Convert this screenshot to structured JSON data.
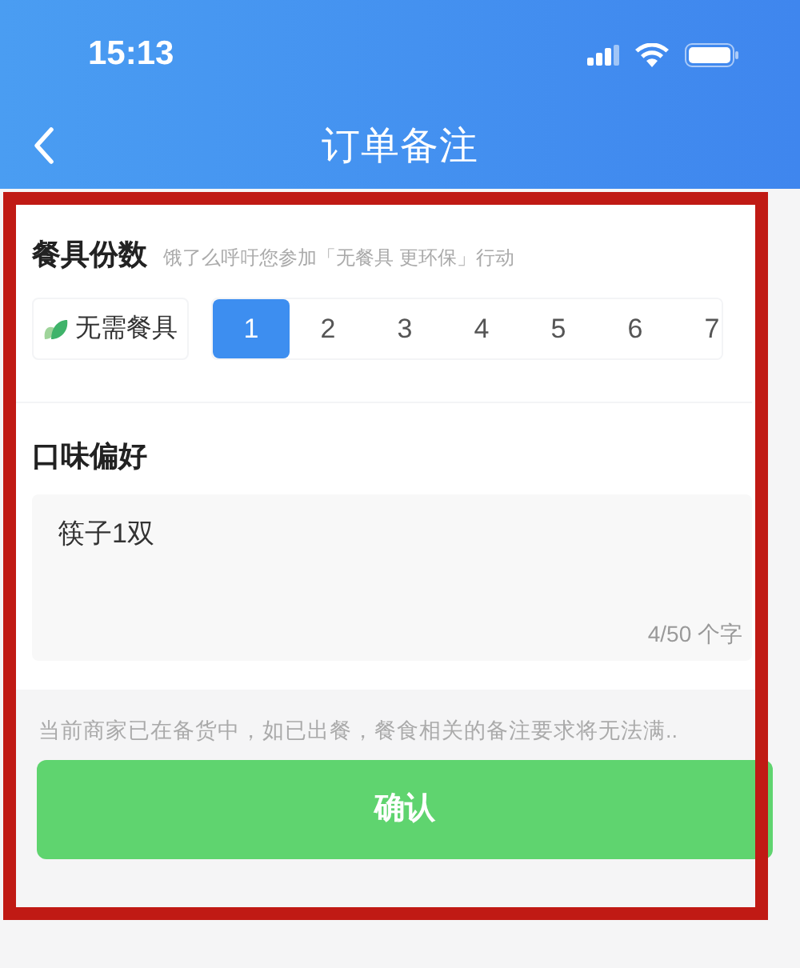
{
  "status_bar": {
    "time": "15:13"
  },
  "nav": {
    "title": "订单备注"
  },
  "tableware": {
    "title": "餐具份数",
    "subtitle": "饿了么呼吁您参加「无餐具 更环保」行动",
    "no_tableware": {
      "label": "无需餐具",
      "selected": false
    },
    "counts": [
      {
        "label": "1",
        "selected": true
      },
      {
        "label": "2",
        "selected": false
      },
      {
        "label": "3",
        "selected": false
      },
      {
        "label": "4",
        "selected": false
      },
      {
        "label": "5",
        "selected": false
      },
      {
        "label": "6",
        "selected": false
      },
      {
        "label": "7",
        "selected": false
      }
    ]
  },
  "taste": {
    "title": "口味偏好",
    "value": "筷子1双",
    "counter": "4/50 个字"
  },
  "notice": "当前商家已在备货中，如已出餐，餐食相关的备注要求将无法满..",
  "confirm_button": "确认"
}
